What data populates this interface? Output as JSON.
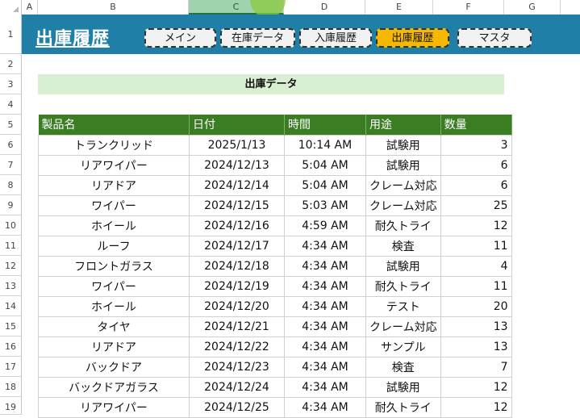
{
  "columns": [
    "A",
    "B",
    "C",
    "D",
    "E",
    "F",
    "G"
  ],
  "rows": [
    "1",
    "2",
    "3",
    "4",
    "5",
    "6",
    "7",
    "8",
    "9",
    "10",
    "11",
    "12",
    "13",
    "14",
    "15",
    "16",
    "17",
    "18",
    "19"
  ],
  "banner": {
    "title": "出庫履歴"
  },
  "nav": [
    "メイン",
    "在庫データ",
    "入庫履歴",
    "出庫履歴",
    "マスタ"
  ],
  "section_title": "出庫データ",
  "table": {
    "headers": [
      "製品名",
      "日付",
      "時間",
      "用途",
      "数量"
    ],
    "rows": [
      [
        "トランクリッド",
        "2025/1/13",
        "10:14 AM",
        "試験用",
        "3"
      ],
      [
        "リアワイパー",
        "2024/12/13",
        "5:04 AM",
        "試験用",
        "6"
      ],
      [
        "リアドア",
        "2024/12/14",
        "5:04 AM",
        "クレーム対応",
        "6"
      ],
      [
        "ワイパー",
        "2024/12/15",
        "5:03 AM",
        "クレーム対応",
        "25"
      ],
      [
        "ホイール",
        "2024/12/16",
        "4:59 AM",
        "耐久トライ",
        "12"
      ],
      [
        "ルーフ",
        "2024/12/17",
        "4:34 AM",
        "検査",
        "11"
      ],
      [
        "フロントガラス",
        "2024/12/18",
        "4:34 AM",
        "試験用",
        "4"
      ],
      [
        "ワイパー",
        "2024/12/19",
        "4:34 AM",
        "耐久トライ",
        "11"
      ],
      [
        "ホイール",
        "2024/12/20",
        "4:34 AM",
        "テスト",
        "20"
      ],
      [
        "タイヤ",
        "2024/12/21",
        "4:34 AM",
        "クレーム対応",
        "13"
      ],
      [
        "リアドア",
        "2024/12/22",
        "4:34 AM",
        "サンプル",
        "13"
      ],
      [
        "バックドア",
        "2024/12/23",
        "4:34 AM",
        "検査",
        "7"
      ],
      [
        "バックドアガラス",
        "2024/12/24",
        "4:34 AM",
        "試験用",
        "12"
      ],
      [
        "リアワイパー",
        "2024/12/25",
        "4:34 AM",
        "耐久トライ",
        "12"
      ]
    ]
  },
  "colors": {
    "banner": "#1f7fa6",
    "header": "#3a7d22",
    "section": "#d9efd1",
    "active_tab": "#f6b800"
  }
}
